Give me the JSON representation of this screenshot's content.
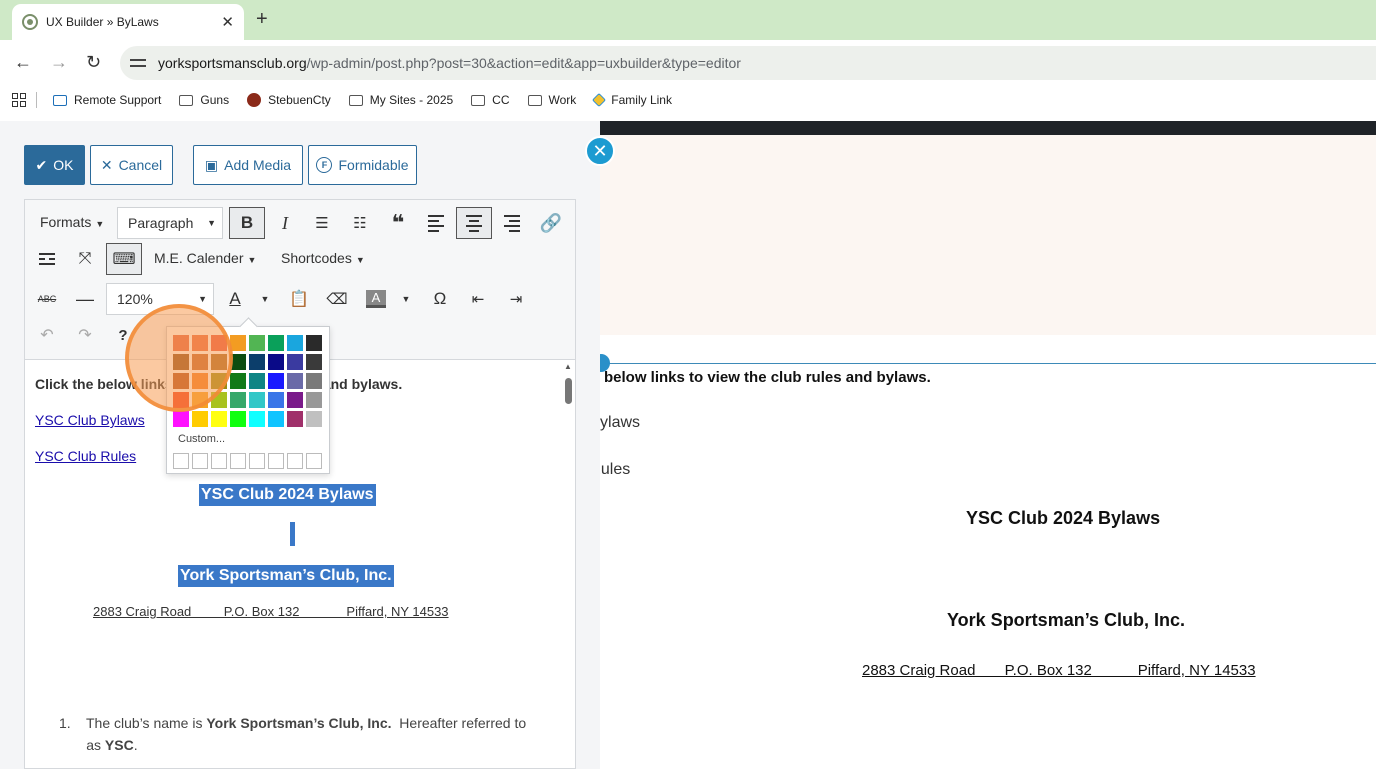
{
  "browser": {
    "tab_title": "UX Builder » ByLaws",
    "url_domain": "yorksportsmansclub.org",
    "url_path": "/wp-admin/post.php?post=30&action=edit&app=uxbuilder&type=editor",
    "bookmarks": [
      "Remote Support",
      "Guns",
      "StebuenCty",
      "My Sites - 2025",
      "CC",
      "Work",
      "Family Link"
    ]
  },
  "editor_buttons": {
    "ok": "OK",
    "cancel": "Cancel",
    "add_media": "Add Media",
    "formidable": "Formidable"
  },
  "toolbar": {
    "formats": "Formats",
    "block_format": "Paragraph",
    "me_calendar": "M.E. Calender",
    "shortcodes": "Shortcodes",
    "font_size": "120%"
  },
  "color_picker": {
    "custom_label": "Custom...",
    "swatches": [
      "#e26040",
      "#e8663e",
      "#e8523c",
      "#f39c22",
      "#52b553",
      "#0aa05a",
      "#1aa6de",
      "#2a2a2a",
      "#8a4b18",
      "#c0632a",
      "#a76621",
      "#0d4d10",
      "#0c3e6b",
      "#0a0a88",
      "#3a3aa0",
      "#3a3a3a",
      "#b04a18",
      "#f27a1f",
      "#9a8a12",
      "#117a18",
      "#0f8585",
      "#1a1aff",
      "#6a6aa8",
      "#7a7a7a",
      "#f23a1a",
      "#f7a222",
      "#a8c21e",
      "#36a86a",
      "#32c7c7",
      "#3a76e8",
      "#7a1a8a",
      "#999999",
      "#ff10ff",
      "#ffcc00",
      "#ffff10",
      "#10ff10",
      "#10ffff",
      "#10c4ff",
      "#a0306a",
      "#c0c0c0"
    ]
  },
  "content": {
    "intro": "Click the below links to view the club rules and bylaws.",
    "link1": "YSC Club Bylaws",
    "link2": "YSC Club Rules",
    "heading1": "YSC Club 2024 Bylaws",
    "heading2": "York Sportsman’s Club, Inc.",
    "address": "2883 Craig Road         P.O. Box 132             Piffard, NY 14533",
    "item1_number": "1.",
    "item1_pre": "The club’s name is ",
    "item1_bold": "York Sportsman’s Club, Inc.",
    "item1_mid": "  Hereafter referred to",
    "item1_line2_pre": "as ",
    "item1_line2_bold": "YSC",
    "item1_line2_post": "."
  },
  "preview": {
    "intro": "below links to view the club rules and bylaws.",
    "link1": "b Bylaws",
    "link2": "b Rules",
    "heading1": "YSC Club 2024 Bylaws",
    "heading2": "York Sportsman’s Club, Inc.",
    "address": "2883 Craig Road       P.O. Box 132           Piffard, NY 14533"
  }
}
